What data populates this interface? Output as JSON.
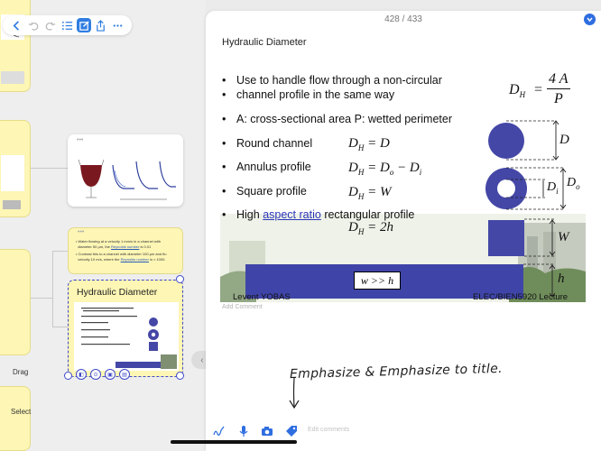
{
  "canvas": {
    "side_chips": {
      "drag": "Drag",
      "select": "Select"
    },
    "text_card": {
      "lines": [
        "Water flowing at a velocity 1 mm/s in a channel with",
        "diameter 50 µm, the",
        "Reynolds number",
        "is 0.01",
        "Contrast this to a channel with diameter 100 µm and flu",
        "velocity 10 m/s, where the",
        "Reynolds number",
        "is ≈ 1000."
      ]
    },
    "selected_card": {
      "title": "Hydraulic Diameter"
    },
    "divider_glyph": "‹ ›"
  },
  "document": {
    "pager": "428 / 433",
    "title": "Hydraulic Diameter",
    "slide": {
      "bullets": [
        "Use to handle flow through a non-circular",
        "channel profile in the same way",
        "A: cross-sectional area P: wetted perimeter",
        "Round channel",
        "Annulus profile",
        "Square profile",
        "High",
        "aspect ratio",
        "rectangular profile"
      ],
      "formulas": {
        "main_lhs": "D",
        "main_sub": "H",
        "main_num": "4 A",
        "main_den": "P",
        "round": "= D",
        "annulus": "= D",
        "annulus_o": "o",
        "annulus_minus": " − D",
        "annulus_i": "i",
        "square": "= W",
        "rect": "= 2h"
      },
      "shape_labels": {
        "d": "D",
        "di": "D",
        "di_sub": "i",
        "do": "D",
        "do_sub": "o",
        "w": "W",
        "h": "h"
      },
      "band_label": "w >> h",
      "footer_left": "Levent YOBAS",
      "footer_right": "ELEC/BIEN5920     Lecture"
    },
    "add_comment": "Add Comment",
    "handwriting": "Emphasize & Emphasize to title.",
    "comments_placeholder": "Edit comments",
    "accent_color": "#2f6ee0",
    "shape_color": "#4447a6"
  }
}
